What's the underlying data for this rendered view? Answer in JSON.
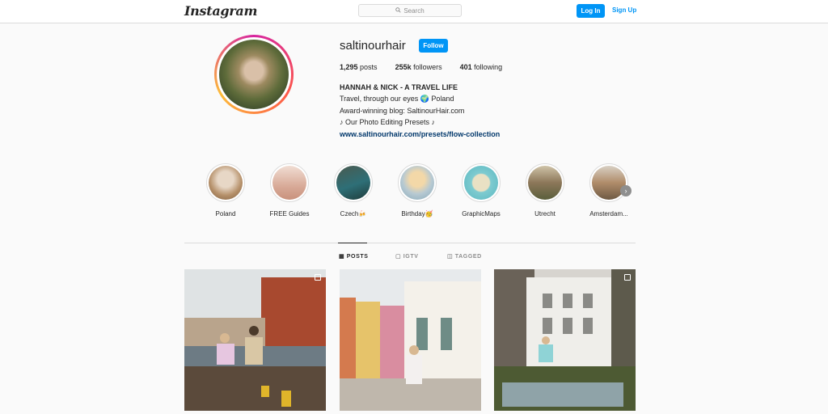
{
  "header": {
    "logo": "Instagram",
    "search_placeholder": "Search",
    "login_label": "Log In",
    "signup_label": "Sign Up"
  },
  "profile": {
    "username": "saltinourhair",
    "follow_label": "Follow",
    "stats": [
      {
        "value": "1,295",
        "label": "posts"
      },
      {
        "value": "255k",
        "label": "followers"
      },
      {
        "value": "401",
        "label": "following"
      }
    ],
    "bio": {
      "name": "HANNAH & NICK - A TRAVEL LIFE",
      "lines": [
        "Travel, through our eyes 🌍 Poland",
        "Award-winning blog: SaltinourHair.com",
        "♪ Our Photo Editing Presets ♪"
      ],
      "link": "www.saltinourhair.com/presets/flow-collection"
    }
  },
  "highlights": [
    {
      "label": "Poland"
    },
    {
      "label": "FREE Guides"
    },
    {
      "label": "Czech🍻"
    },
    {
      "label": "Birthday🥳"
    },
    {
      "label": "GraphicMaps"
    },
    {
      "label": "Utrecht"
    },
    {
      "label": "Amsterdam..."
    }
  ],
  "tabs": [
    {
      "label": "POSTS",
      "icon": "grid-icon"
    },
    {
      "label": "IGTV",
      "icon": "igtv-icon"
    },
    {
      "label": "TAGGED",
      "icon": "tagged-icon"
    }
  ],
  "colors": {
    "accent": "#0095f6",
    "link": "#00376b"
  }
}
